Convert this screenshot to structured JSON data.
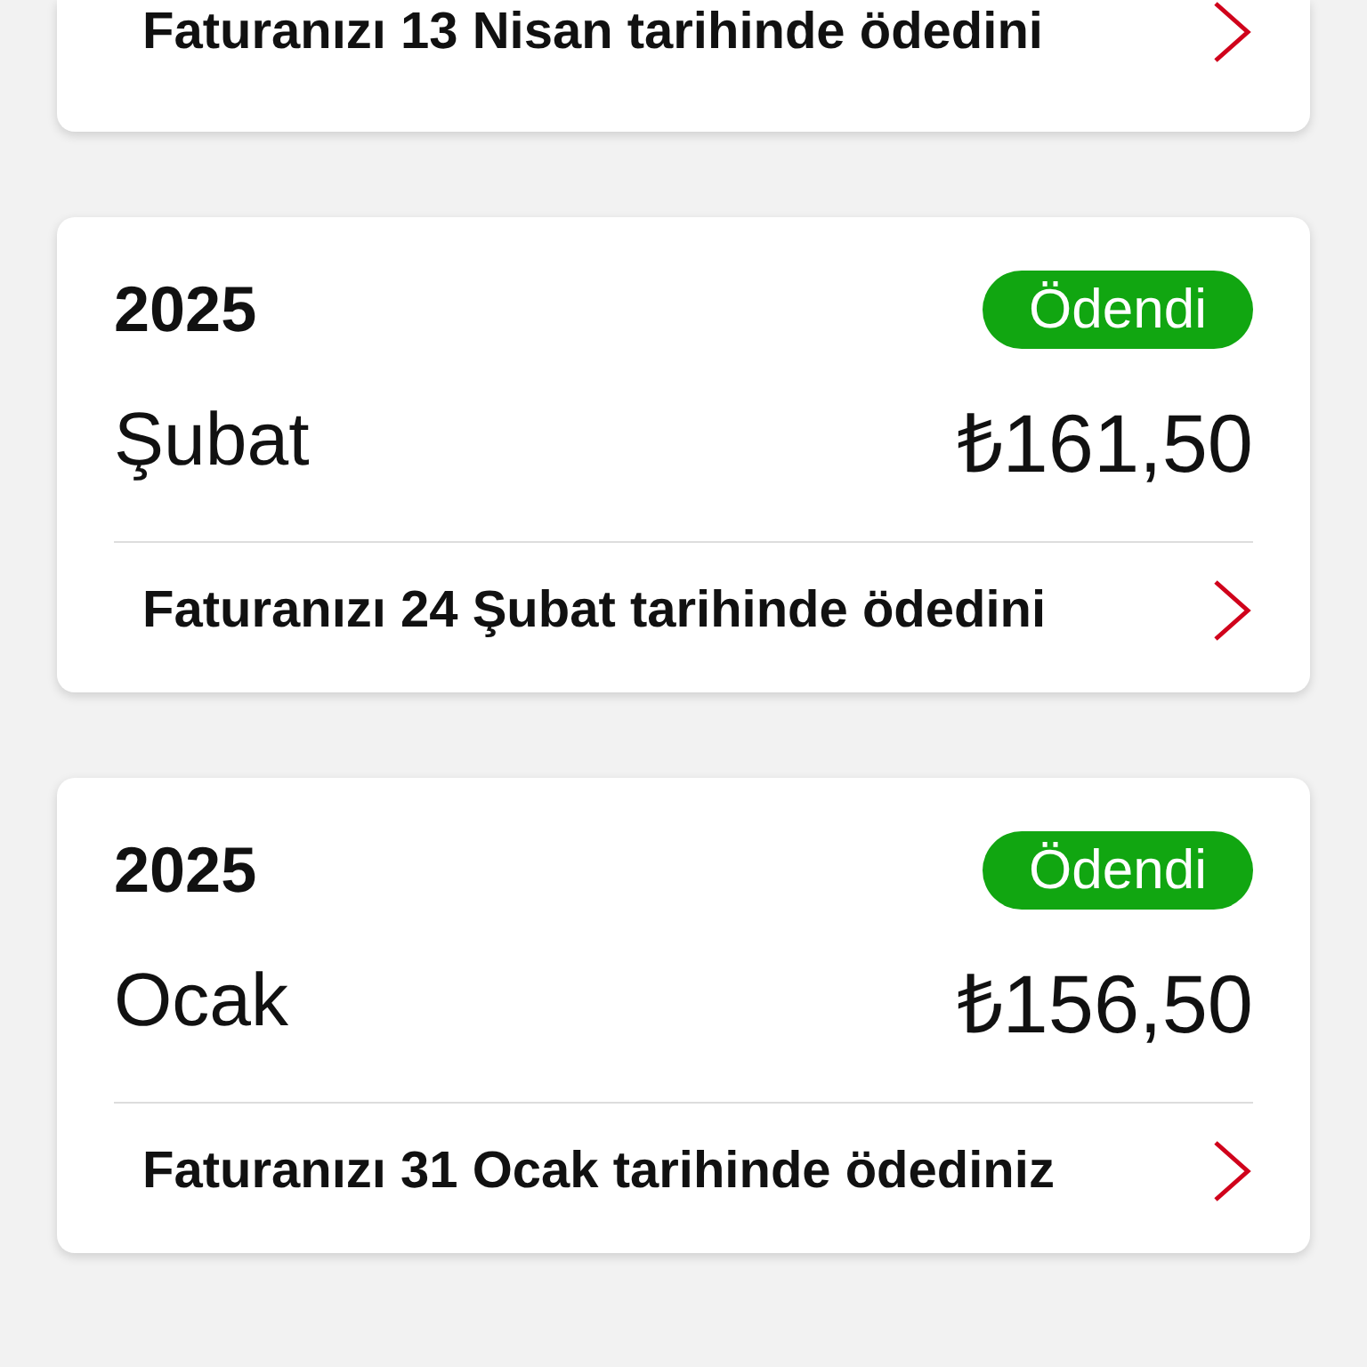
{
  "bills": [
    {
      "note": "Faturanızı 13 Nisan tarihinde ödedini"
    },
    {
      "year": "2025",
      "status": "Ödendi",
      "month": "Şubat",
      "amount": "₺161,50",
      "note": "Faturanızı 24 Şubat tarihinde ödedini"
    },
    {
      "year": "2025",
      "status": "Ödendi",
      "month": "Ocak",
      "amount": "₺156,50",
      "note": "Faturanızı 31 Ocak tarihinde ödediniz"
    }
  ]
}
